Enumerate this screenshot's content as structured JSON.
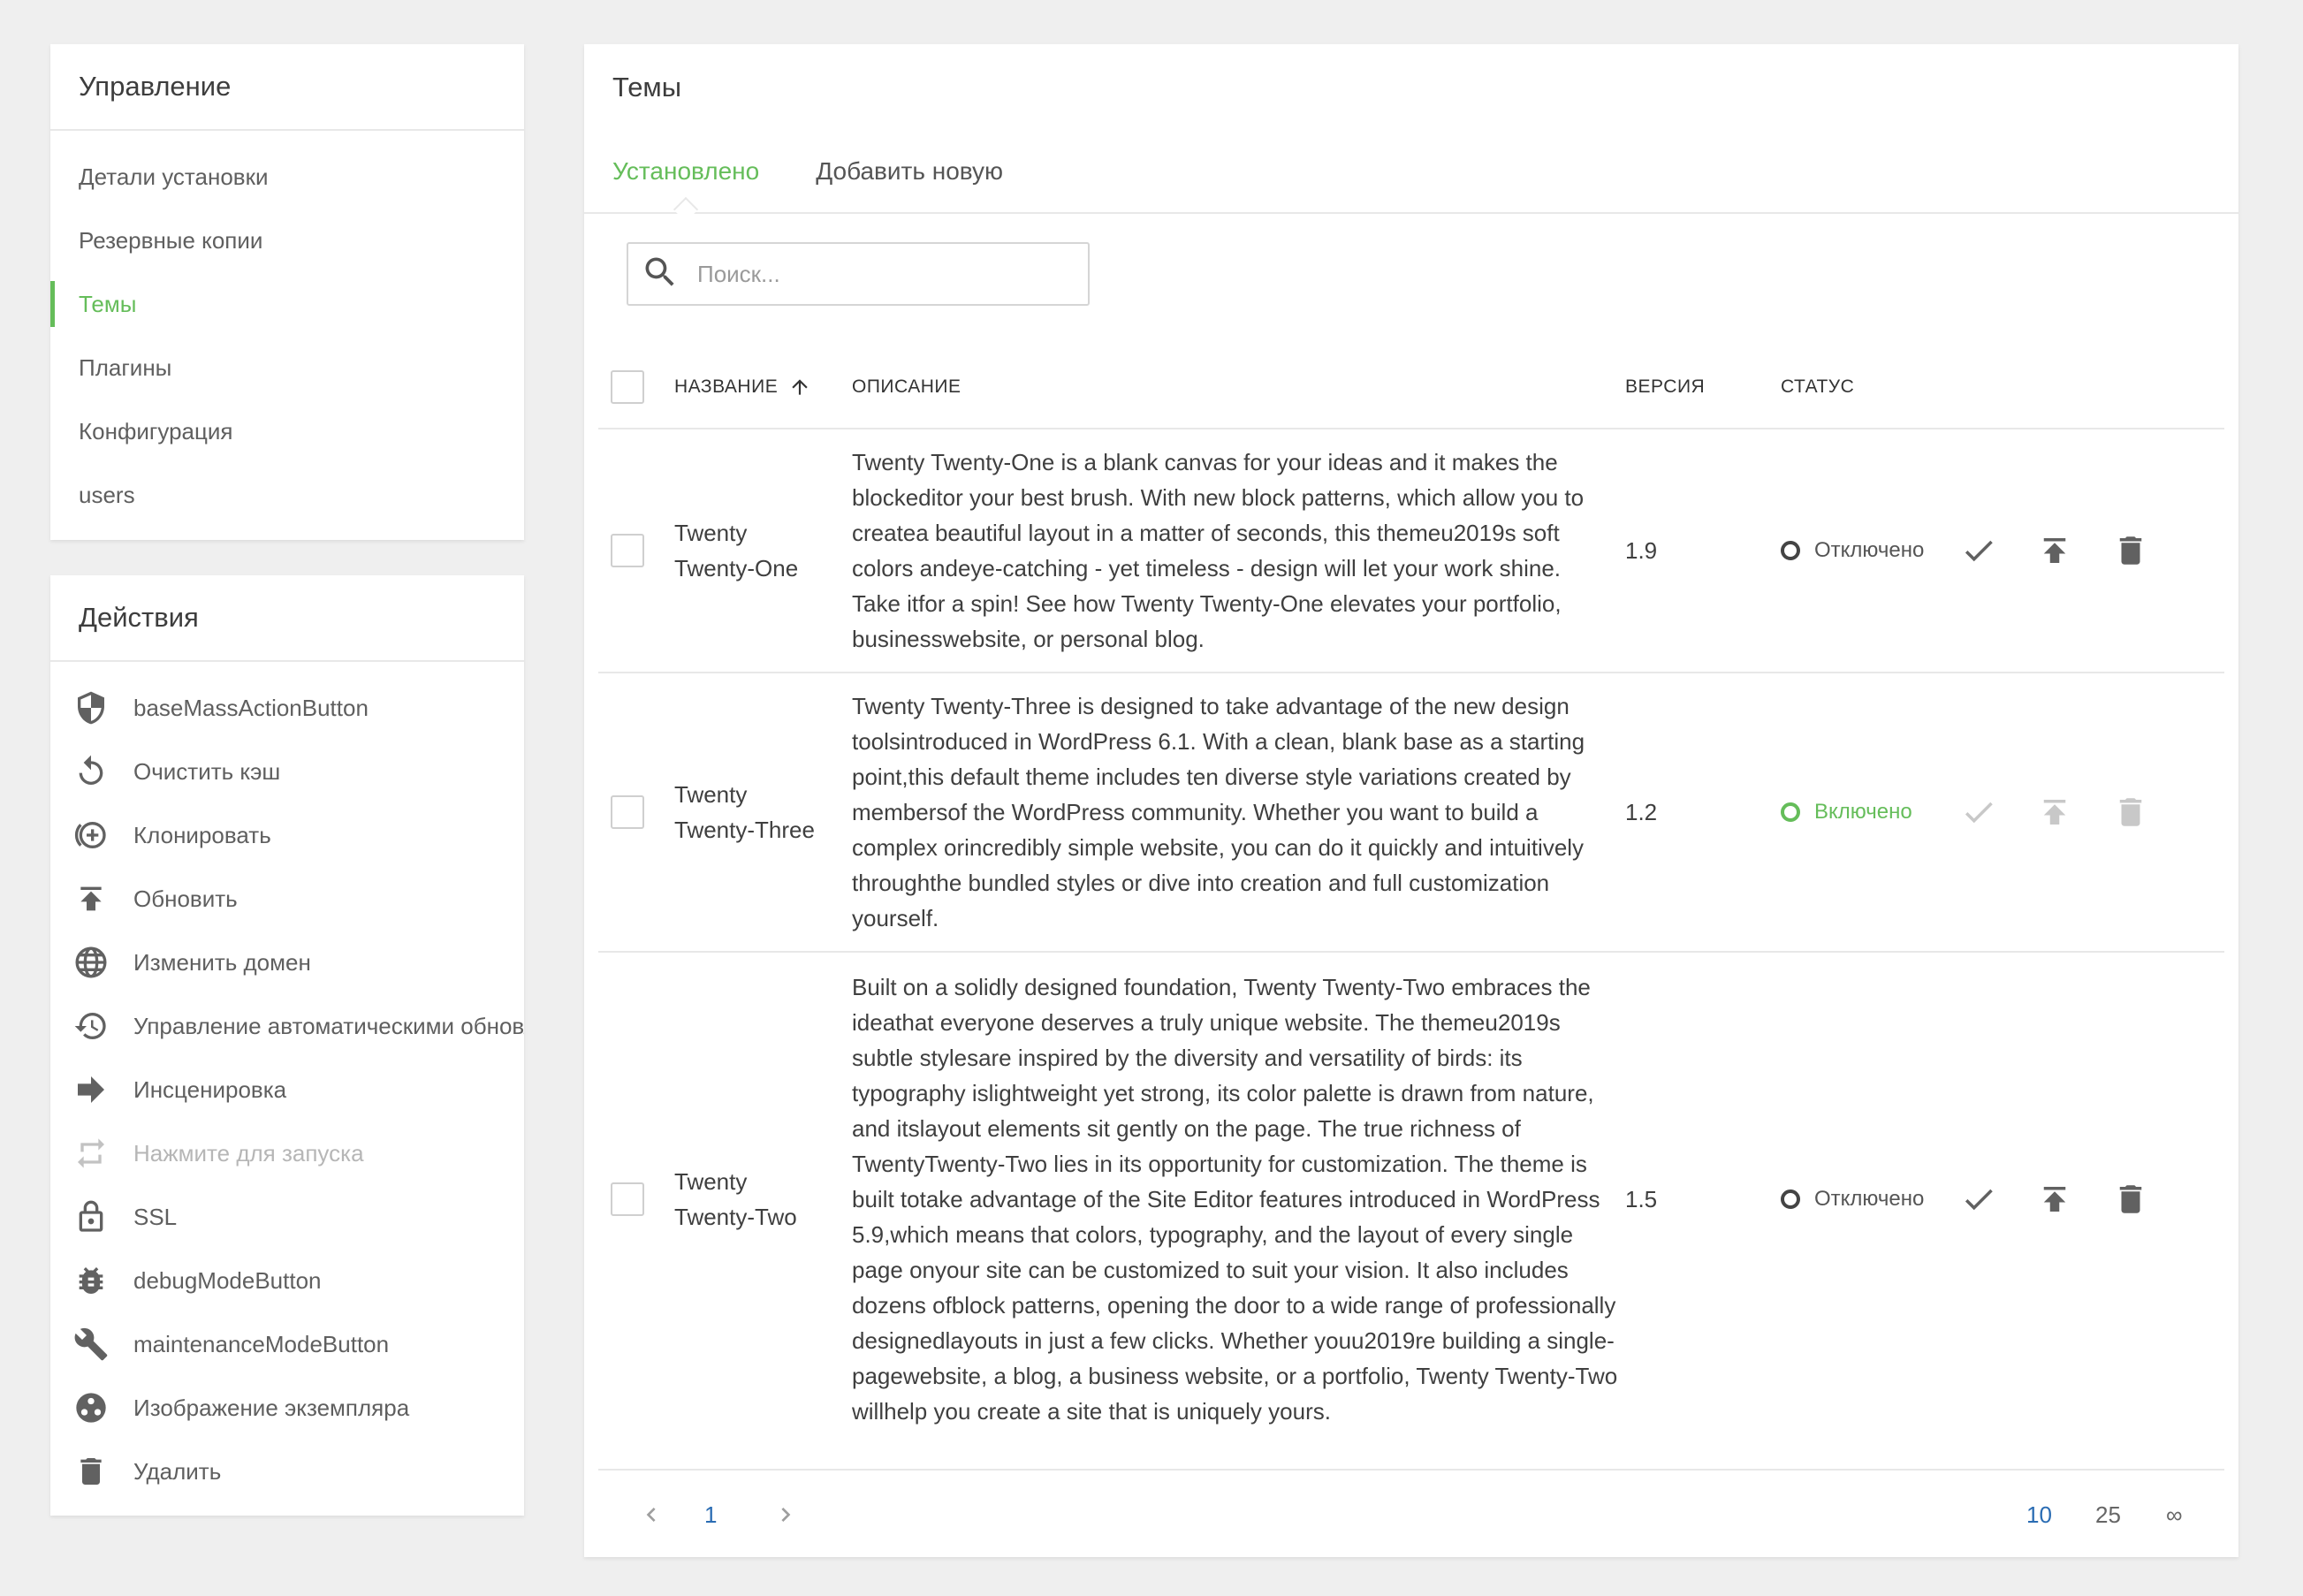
{
  "management": {
    "title": "Управление",
    "items": [
      {
        "label": "Детали установки"
      },
      {
        "label": "Резервные копии"
      },
      {
        "label": "Темы"
      },
      {
        "label": "Плагины"
      },
      {
        "label": "Конфигурация"
      },
      {
        "label": "users"
      }
    ],
    "active_index": 2
  },
  "actions": {
    "title": "Действия",
    "items": [
      {
        "label": "baseMassActionButton",
        "icon": "shield-icon"
      },
      {
        "label": "Очистить кэш",
        "icon": "refresh-icon"
      },
      {
        "label": "Клонировать",
        "icon": "clone-icon"
      },
      {
        "label": "Обновить",
        "icon": "upload-icon"
      },
      {
        "label": "Изменить домен",
        "icon": "globe-icon"
      },
      {
        "label": "Управление автоматическими обновлениями",
        "icon": "history-icon"
      },
      {
        "label": "Инсценировка",
        "icon": "arrow-right-icon"
      },
      {
        "label": "Нажмите для запуска",
        "icon": "repeat-icon",
        "disabled": true
      },
      {
        "label": "SSL",
        "icon": "lock-icon"
      },
      {
        "label": "debugModeButton",
        "icon": "bug-icon"
      },
      {
        "label": "maintenanceModeButton",
        "icon": "wrench-icon"
      },
      {
        "label": "Изображение экземпляра",
        "icon": "instance-image-icon"
      },
      {
        "label": "Удалить",
        "icon": "trash-icon"
      }
    ]
  },
  "main": {
    "title": "Темы",
    "tabs": [
      {
        "label": "Установлено",
        "active": true
      },
      {
        "label": "Добавить новую",
        "active": false
      }
    ],
    "search": {
      "placeholder": "Поиск...",
      "value": ""
    },
    "columns": {
      "name": "НАЗВАНИЕ",
      "description": "ОПИСАНИЕ",
      "version": "ВЕРСИЯ",
      "status": "СТАТУС"
    },
    "rows": [
      {
        "name": "Twenty Twenty-One",
        "description": "Twenty Twenty-One is a blank canvas for your ideas and it makes the blockeditor your best brush. With new block patterns, which allow you to createa beautiful layout in a matter of seconds, this themeu2019s soft colors andeye-catching - yet timeless - design will let your work shine. Take itfor a spin! See how Twenty Twenty-One elevates your portfolio, businesswebsite, or personal blog.",
        "version": "1.9",
        "status": "Отключено",
        "enabled": false
      },
      {
        "name": "Twenty Twenty-Three",
        "description": "Twenty Twenty-Three is designed to take advantage of the new design toolsintroduced in WordPress 6.1. With a clean, blank base as a starting point,this default theme includes ten diverse style variations created by membersof the WordPress community. Whether you want to build a complex orincredibly simple website, you can do it quickly and intuitively throughthe bundled styles or dive into creation and full customization yourself.",
        "version": "1.2",
        "status": "Включено",
        "enabled": true
      },
      {
        "name": "Twenty Twenty-Two",
        "description": "Built on a solidly designed foundation, Twenty Twenty-Two embraces the ideathat everyone deserves a truly unique website. The themeu2019s subtle stylesare inspired by the diversity and versatility of birds: its typography islightweight yet strong, its color palette is drawn from nature, and itslayout elements sit gently on the page. The true richness of TwentyTwenty-Two lies in its opportunity for customization. The theme is built totake advantage of the Site Editor features introduced in WordPress 5.9,which means that colors, typography, and the layout of every single page onyour site can be customized to suit your vision. It also includes dozens ofblock patterns, opening the door to a wide range of professionally designedlayouts in just a few clicks. Whether youu2019re building a single-pagewebsite, a blog, a business website, or a portfolio, Twenty Twenty-Two willhelp you create a site that is uniquely yours.",
        "version": "1.5",
        "status": "Отключено",
        "enabled": false
      }
    ],
    "pagination": {
      "current_page": "1",
      "page_sizes": [
        "10",
        "25",
        "∞"
      ],
      "active_page_size": "10"
    }
  },
  "colors": {
    "accent": "#65bd5a",
    "link_blue": "#2a6cb3",
    "icon_gray": "#616161",
    "disabled": "#bdbdbd"
  }
}
